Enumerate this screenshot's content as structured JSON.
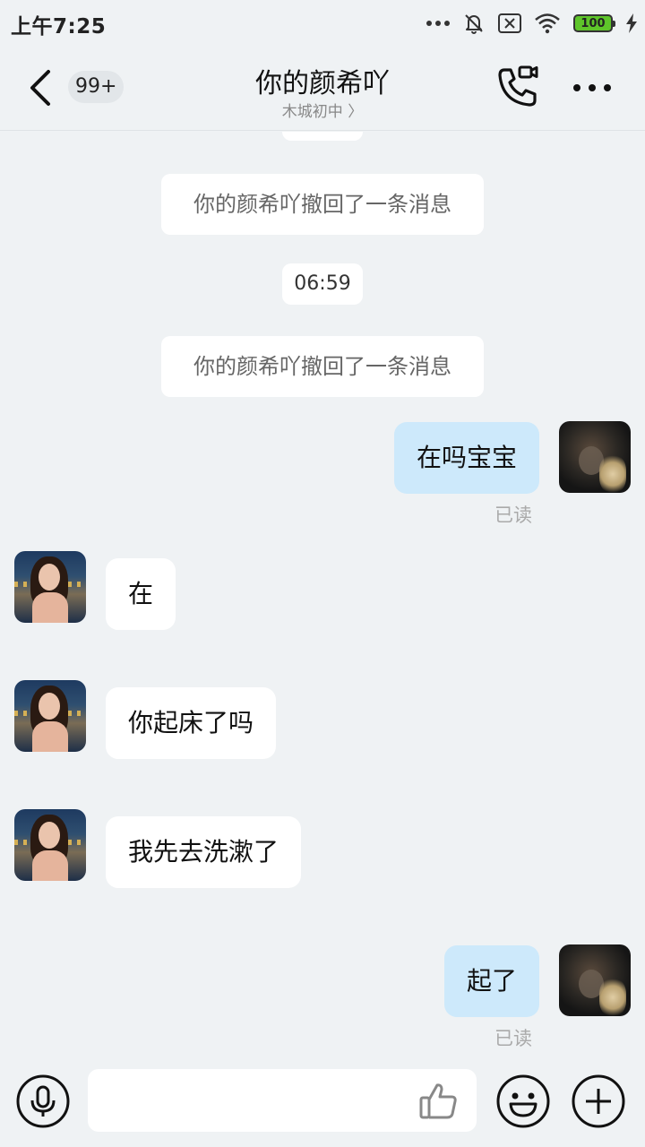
{
  "status_bar": {
    "time": "上午7:25",
    "battery": "100"
  },
  "header": {
    "unread_count": "99+",
    "title": "你的颜希吖",
    "subtitle": "木城初中 〉"
  },
  "messages": {
    "system_recall_1": "你的颜希吖撤回了一条消息",
    "timestamp_1": "06:59",
    "system_recall_2": "你的颜希吖撤回了一条消息",
    "sent_1": "在吗宝宝",
    "read_1": "已读",
    "received_1": "在",
    "received_2": "你起床了吗",
    "received_3": "我先去洗漱了",
    "sent_2": "起了",
    "read_2": "已读"
  },
  "input": {
    "placeholder": "",
    "value": ""
  },
  "colors": {
    "background": "#eff2f4",
    "sent_bubble": "#cde9fb",
    "received_bubble": "#ffffff",
    "battery_fill": "#5ec52a"
  },
  "icons": {
    "back": "chevron-left-icon",
    "call": "video-call-icon",
    "more": "more-dots-icon",
    "voice": "microphone-icon",
    "like": "thumbs-up-icon",
    "emoji": "smiley-icon",
    "add": "plus-icon"
  }
}
